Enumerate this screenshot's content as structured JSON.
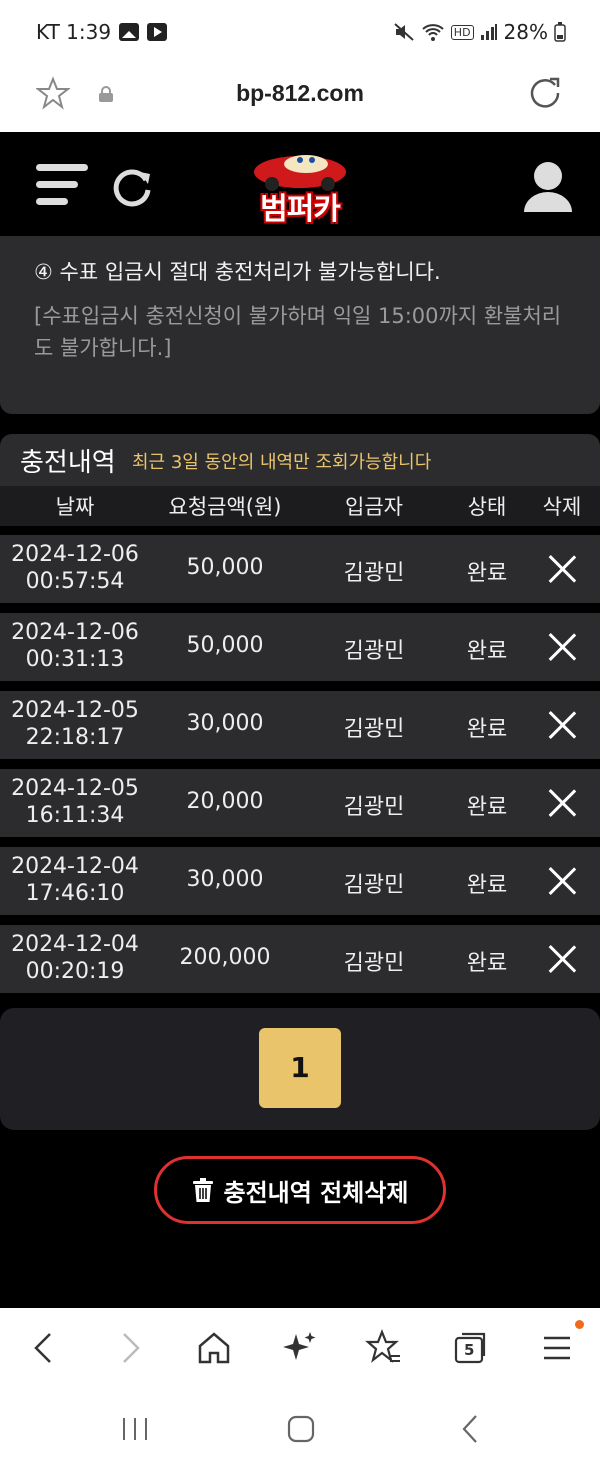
{
  "status_bar": {
    "carrier_time": "KT 1:39",
    "hd": "HD",
    "battery": "28%"
  },
  "address_bar": {
    "url": "bp-812.com"
  },
  "header": {
    "logo_text": "범퍼카"
  },
  "notice": {
    "line1": "④ 수표 입금시 절대 충전처리가 불가능합니다.",
    "line2": "[수표입금시 충전신청이 불가하며 익일 15:00까지 환불처리도 불가합니다.]"
  },
  "history": {
    "title": "충전내역",
    "subtitle": "최근 3일 동안의 내역만 조회가능합니다",
    "columns": [
      "날짜",
      "요청금액(원)",
      "입금자",
      "상태",
      "삭제"
    ],
    "rows": [
      {
        "date": "2024-12-06",
        "time": "00:57:54",
        "amount": "50,000",
        "depositor": "김광민",
        "status": "완료"
      },
      {
        "date": "2024-12-06",
        "time": "00:31:13",
        "amount": "50,000",
        "depositor": "김광민",
        "status": "완료"
      },
      {
        "date": "2024-12-05",
        "time": "22:18:17",
        "amount": "30,000",
        "depositor": "김광민",
        "status": "완료"
      },
      {
        "date": "2024-12-05",
        "time": "16:11:34",
        "amount": "20,000",
        "depositor": "김광민",
        "status": "완료"
      },
      {
        "date": "2024-12-04",
        "time": "17:46:10",
        "amount": "30,000",
        "depositor": "김광민",
        "status": "완료"
      },
      {
        "date": "2024-12-04",
        "time": "00:20:19",
        "amount": "200,000",
        "depositor": "김광민",
        "status": "완료"
      }
    ]
  },
  "pagination": {
    "current_page": "1"
  },
  "delete_all_label": "충전내역 전체삭제",
  "browser_nav": {
    "tabs_count": "5"
  },
  "colors": {
    "accent": "#e9c46a",
    "danger": "#e03131",
    "panel": "#2c2c2e"
  }
}
